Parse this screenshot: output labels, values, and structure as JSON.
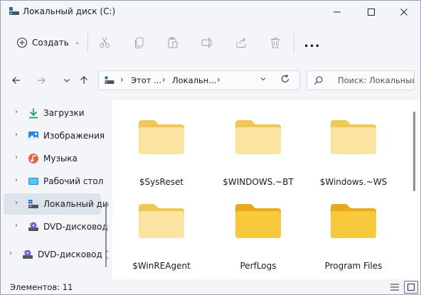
{
  "window": {
    "title": "Локальный диск (C:)"
  },
  "commands": {
    "create_label": "Создать",
    "icons": [
      "cut-icon",
      "copy-icon",
      "paste-icon",
      "rename-icon",
      "share-icon",
      "delete-icon"
    ],
    "more_label": "..."
  },
  "address": {
    "crumbs": [
      "Этот ...",
      "Локальн..."
    ],
    "search_placeholder": "Поиск: Локальный диск (C:)"
  },
  "nav": {
    "items": [
      {
        "label": "Загрузки",
        "icon": "downloads-icon"
      },
      {
        "label": "Изображения",
        "icon": "pictures-icon"
      },
      {
        "label": "Музыка",
        "icon": "music-icon"
      },
      {
        "label": "Рабочий стол",
        "icon": "desktop-icon"
      },
      {
        "label": "Локальный диск (C:)",
        "icon": "drive-icon",
        "selected": true
      },
      {
        "label": "DVD-дисковод (D:)",
        "icon": "dvd-icon"
      },
      {
        "label": "DVD-дисковод (D:)",
        "icon": "dvd-icon"
      }
    ]
  },
  "files": [
    {
      "name": "$SysReset",
      "variant": "light"
    },
    {
      "name": "$WINDOWS.~BT",
      "variant": "light"
    },
    {
      "name": "$Windows.~WS",
      "variant": "light"
    },
    {
      "name": "$WinREAgent",
      "variant": "light"
    },
    {
      "name": "PerfLogs",
      "variant": "solid"
    },
    {
      "name": "Program Files",
      "variant": "solid"
    }
  ],
  "status": {
    "item_count": "Элементов: 11"
  },
  "colors": {
    "folder_light": "#f8dd8a",
    "folder_solid": "#f5c53a",
    "accent": "#0067c0"
  }
}
